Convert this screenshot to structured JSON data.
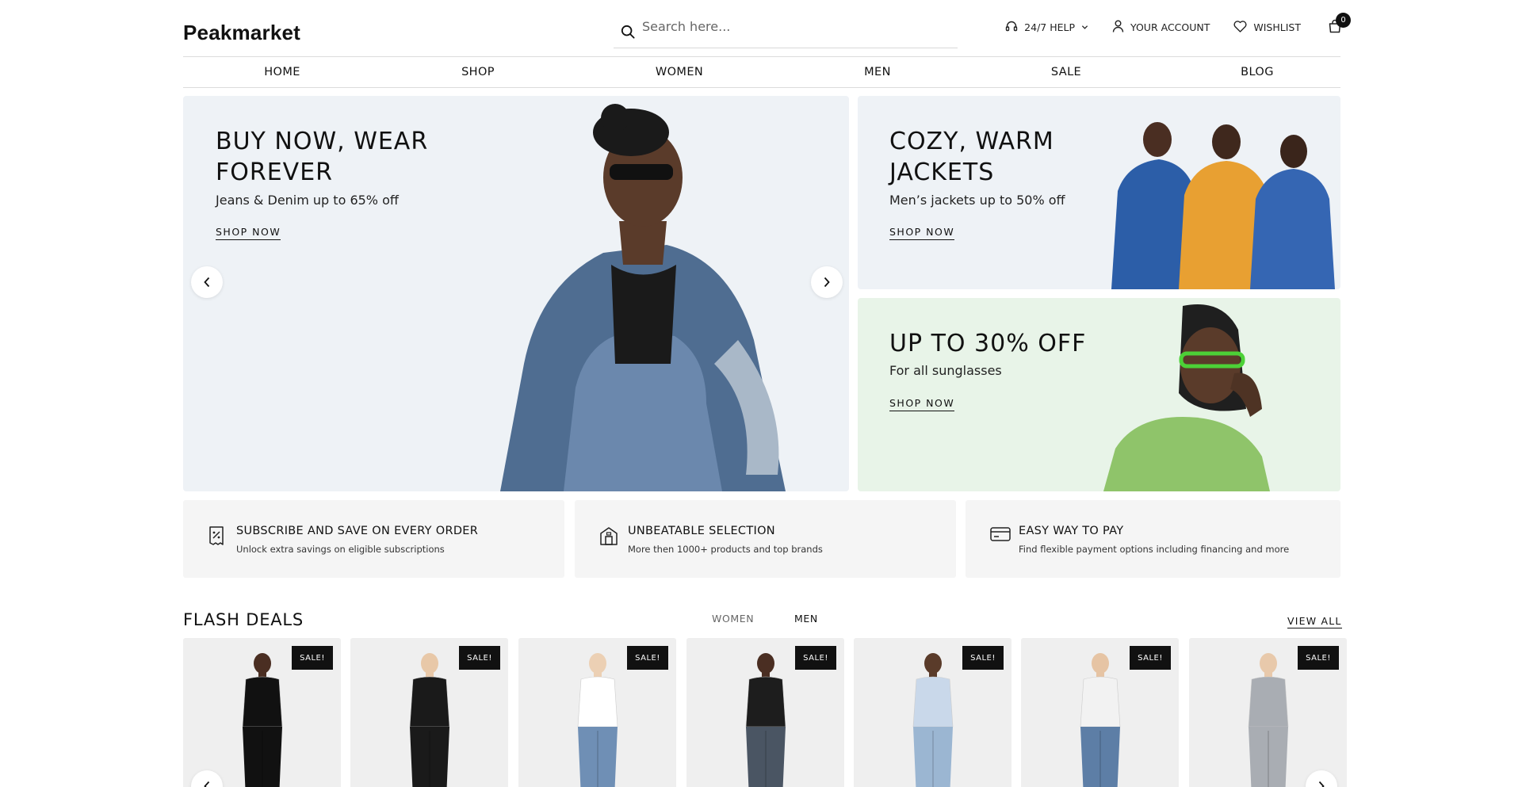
{
  "header": {
    "logo": "Peakmarket",
    "search_placeholder": "Search here...",
    "help_label": "24/7 HELP",
    "account_label": "YOUR ACCOUNT",
    "wishlist_label": "WISHLIST",
    "cart_count": "0"
  },
  "nav": [
    "HOME",
    "SHOP",
    "WOMEN",
    "MEN",
    "SALE",
    "BLOG"
  ],
  "banners": {
    "main": {
      "title_line1": "BUY NOW, WEAR",
      "title_line2": "FOREVER",
      "subtitle": "Jeans & Denim up to 65% off",
      "cta": "SHOP NOW"
    },
    "jackets": {
      "title_line1": "COZY, WARM",
      "title_line2": "JACKETS",
      "subtitle": "Men’s jackets up to 50% off",
      "cta": "SHOP NOW"
    },
    "sunglasses": {
      "title": "UP TO 30% OFF",
      "subtitle": "For all sunglasses",
      "cta": "SHOP NOW"
    }
  },
  "features": [
    {
      "icon": "receipt-percent-icon",
      "title": "SUBSCRIBE AND SAVE ON EVERY ORDER",
      "subtitle": "Unlock extra savings on eligible subscriptions"
    },
    {
      "icon": "store-icon",
      "title": "UNBEATABLE SELECTION",
      "subtitle": "More then 1000+ products and top brands"
    },
    {
      "icon": "credit-card-icon",
      "title": "EASY WAY TO PAY",
      "subtitle": "Find flexible payment options including financing and more"
    }
  ],
  "flash_deals": {
    "title": "FLASH DEALS",
    "tabs": [
      "WOMEN",
      "MEN"
    ],
    "active_tab": "MEN",
    "view_all": "VIEW ALL",
    "sale_badge": "SALE!",
    "product_count": 7
  },
  "colors": {
    "banner_blue": "#eef2f6",
    "banner_green": "#e8f4e8",
    "feature_bg": "#f5f5f5",
    "text": "#111111"
  }
}
